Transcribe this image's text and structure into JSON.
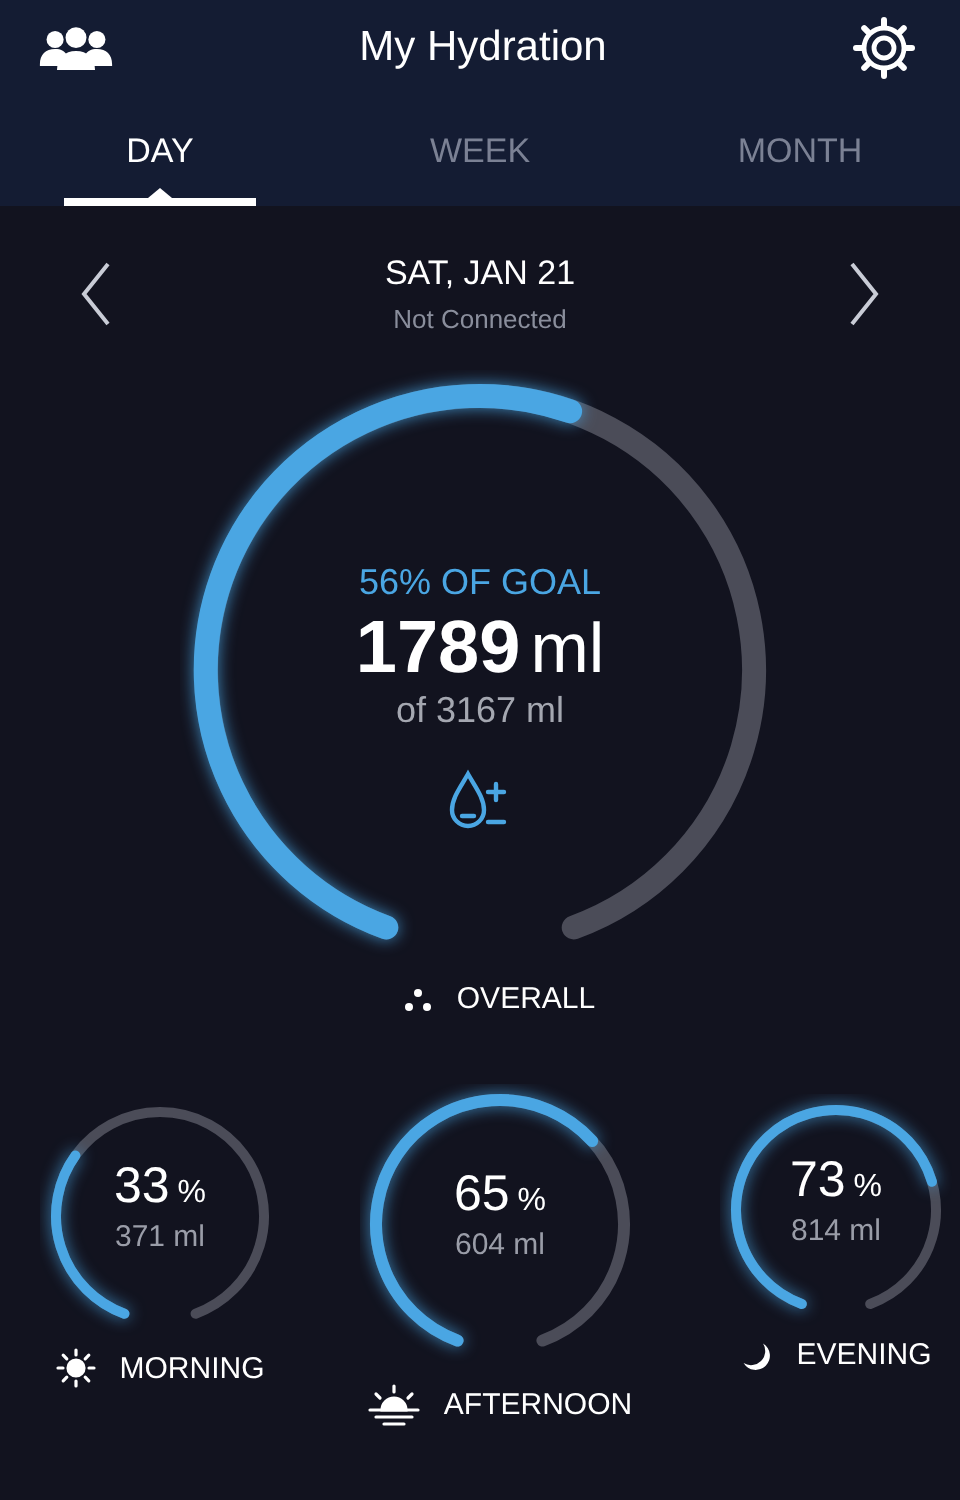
{
  "header": {
    "title": "My Hydration"
  },
  "tabs": [
    {
      "label": "DAY",
      "selected": true
    },
    {
      "label": "WEEK",
      "selected": false
    },
    {
      "label": "MONTH",
      "selected": false
    }
  ],
  "date": {
    "label": "SAT, JAN 21",
    "status": "Not Connected"
  },
  "overall": {
    "goal_text": "56% OF GOAL",
    "amount": "1789",
    "amount_unit": "ml",
    "target": "of 3167 ml",
    "label": "OVERALL"
  },
  "periods": [
    {
      "kind": "morning",
      "percent": "33",
      "unit": "%",
      "amount": "371 ml",
      "label": "MORNING"
    },
    {
      "kind": "afternoon",
      "percent": "65",
      "unit": "%",
      "amount": "604 ml",
      "label": "AFTERNOON"
    },
    {
      "kind": "evening",
      "percent": "73",
      "unit": "%",
      "amount": "814 ml",
      "label": "EVENING"
    }
  ]
}
